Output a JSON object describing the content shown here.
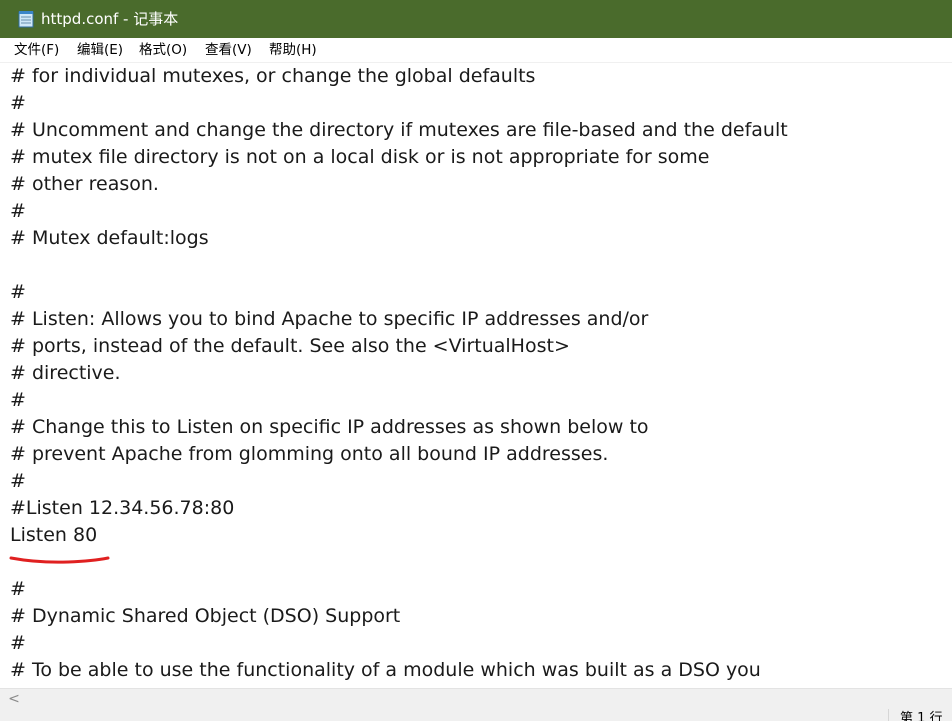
{
  "window": {
    "title": "httpd.conf - 记事本",
    "title_icon": "notepad-icon",
    "titlebar_color": "#4a6b2c"
  },
  "menu": {
    "items": [
      {
        "label": "文件(F)"
      },
      {
        "label": "编辑(E)"
      },
      {
        "label": "格式(O)"
      },
      {
        "label": "查看(V)"
      },
      {
        "label": "帮助(H)"
      }
    ]
  },
  "editor": {
    "lines": [
      "# for individual mutexes, or change the global defaults",
      "#",
      "# Uncomment and change the directory if mutexes are file-based and the default",
      "# mutex file directory is not on a local disk or is not appropriate for some",
      "# other reason.",
      "#",
      "# Mutex default:logs",
      "",
      "#",
      "# Listen: Allows you to bind Apache to specific IP addresses and/or",
      "# ports, instead of the default. See also the <VirtualHost>",
      "# directive.",
      "#",
      "# Change this to Listen on specific IP addresses as shown below to",
      "# prevent Apache from glomming onto all bound IP addresses.",
      "#",
      "#Listen 12.34.56.78:80",
      "Listen 80",
      "",
      "#",
      "# Dynamic Shared Object (DSO) Support",
      "#",
      "# To be able to use the functionality of a module which was built as a DSO you"
    ],
    "annotation_color": "#e02020"
  },
  "scrollbar": {
    "left_arrow": "<"
  },
  "status": {
    "text": "第 1 行"
  }
}
